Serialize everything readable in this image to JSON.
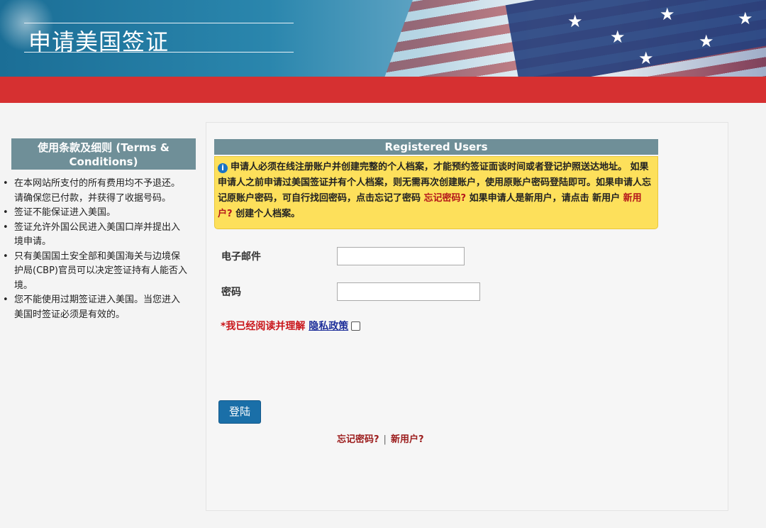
{
  "header": {
    "title": "申请美国签证"
  },
  "sidebar": {
    "title": "使用条款及细则 (Terms & Conditions)",
    "items": [
      "在本网站所支付的所有费用均不予退还。请确保您已付款，并获得了收据号码。",
      "签证不能保证进入美国。",
      "签证允许外国公民进入美国口岸并提出入境申请。",
      "只有美国国土安全部和美国海关与边境保护局(CBP)官员可以决定签证持有人能否入境。",
      "您不能使用过期签证进入美国。当您进入美国时签证必须是有效的。"
    ]
  },
  "main": {
    "section_title": "Registered Users",
    "notice": {
      "text_1": "申请人必须在线注册账户并创建完整的个人档案，才能预约签证面谈时间或者登记护照送达地址。 如果申请人之前申请过美国签证并有个人档案，则无需再次创建账户，使用原账户密码登陆即可。如果申请人忘记原账户密码，可自行找回密码，点击忘记了密码 ",
      "forgot_link": "忘记密码?",
      "text_2": " 如果申请人是新用户，请点击 新用户 ",
      "new_user_link": "新用户?",
      "text_3": " 创建个人档案。"
    },
    "email_label": "电子邮件",
    "email_value": "",
    "password_label": "密码",
    "password_value": "",
    "agree_prefix": "*我已经阅读并理解 ",
    "privacy_link": "隐私政策",
    "login_button": "登陆",
    "bottom_forgot": "忘记密码?",
    "bottom_separator": "|",
    "bottom_new_user": "新用户?"
  },
  "colors": {
    "red_band": "#d63031",
    "section_header": "#6f8f98",
    "notice_bg": "#fde05b",
    "button": "#1a6fa8"
  }
}
